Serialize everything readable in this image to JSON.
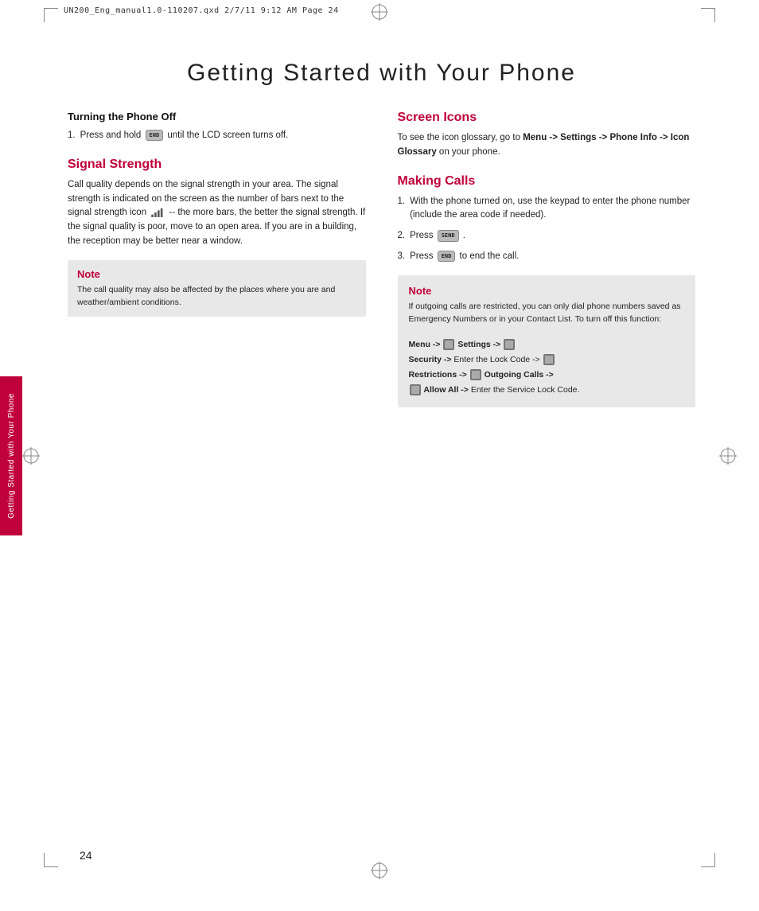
{
  "page": {
    "print_header": "UN200_Eng_manual1.0-110207.qxd   2/7/11   9:12 AM   Page 24",
    "page_number": "24",
    "title": "Getting Started with Your Phone",
    "side_tab_text": "Getting Started with Your Phone"
  },
  "left_col": {
    "section1": {
      "heading": "Turning the Phone Off",
      "steps": [
        {
          "num": "1.",
          "text": "Press and hold",
          "icon": "END",
          "text2": "until the LCD screen turns off."
        }
      ]
    },
    "section2": {
      "heading": "Signal Strength",
      "body": "Call quality depends on the signal strength in your area. The signal strength is indicated on the screen as the number of bars next to the signal strength icon",
      "body2": "-- the more bars, the better the signal strength. If the signal quality is poor, move to an open area. If you are in a building, the reception may be better near a window."
    },
    "note": {
      "title": "Note",
      "text": "The call quality may also be affected by the places where you are and weather/ambient conditions."
    }
  },
  "right_col": {
    "section1": {
      "heading": "Screen Icons",
      "body": "To see the icon glossary, go to",
      "menu_path": "Menu -> Settings -> Phone Info -> Icon Glossary",
      "body2": "on your phone."
    },
    "section2": {
      "heading": "Making Calls",
      "steps": [
        {
          "num": "1.",
          "text": "With the phone turned on, use the keypad to enter the phone number (include the area code if needed)."
        },
        {
          "num": "2.",
          "text": "Press",
          "icon": "SEND",
          "text2": "."
        },
        {
          "num": "3.",
          "text": "Press",
          "icon": "END",
          "text2": "to end the call."
        }
      ]
    },
    "note": {
      "title": "Note",
      "intro": "If outgoing calls are restricted, you can only dial phone numbers saved as Emergency Numbers or in your Contact List. To turn off this function:",
      "menu_lines": [
        {
          "prefix": "Menu ->",
          "icon": "S",
          "text": "Settings ->",
          "icon2": "S"
        },
        {
          "prefix": "Security ->",
          "text": "Enter the Lock Code ->",
          "icon2": "L"
        },
        {
          "prefix": "Restrictions ->",
          "icon": "R",
          "text": "Outgoing Calls ->"
        },
        {
          "prefix": "",
          "icon": "R",
          "text": "Allow All ->Enter the Service Lock Code."
        }
      ]
    }
  }
}
